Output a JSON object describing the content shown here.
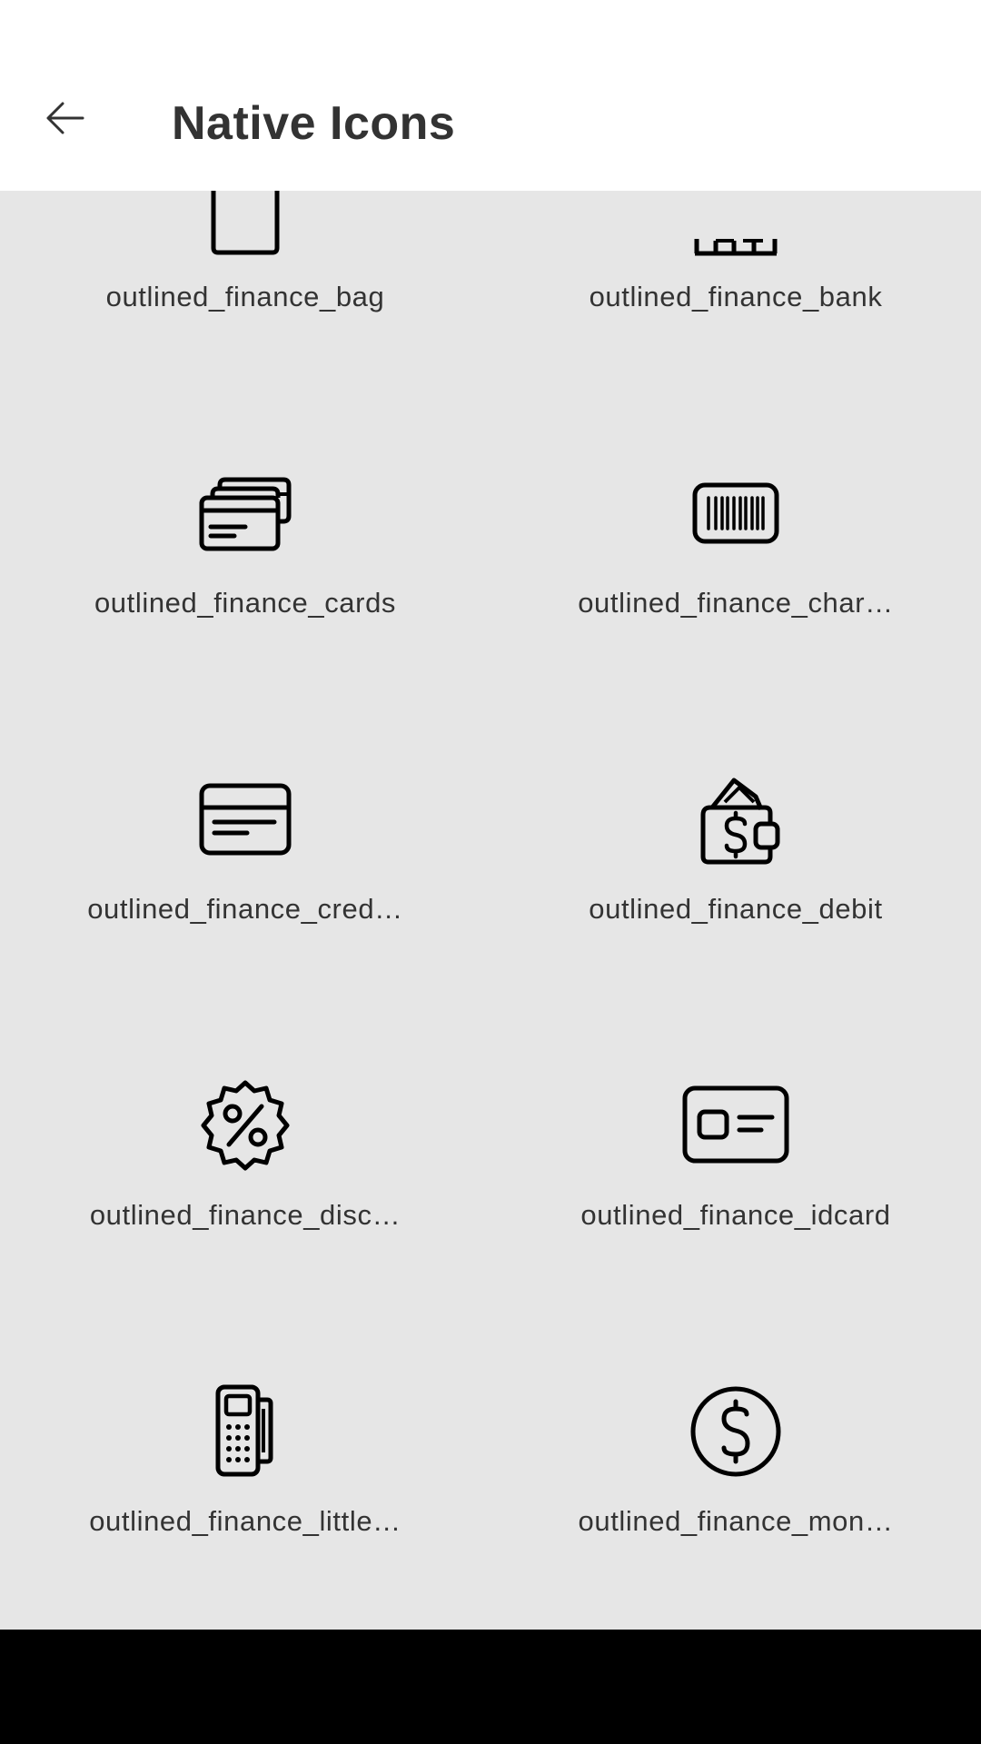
{
  "header": {
    "title": "Native Icons",
    "back_icon": "arrow-left-icon"
  },
  "icons": [
    {
      "label": "outlined_finance_bag",
      "icon": "finance-bag-icon"
    },
    {
      "label": "outlined_finance_bank",
      "icon": "finance-bank-icon"
    },
    {
      "label": "outlined_finance_cards",
      "icon": "finance-cards-icon"
    },
    {
      "label": "outlined_finance_char…",
      "icon": "finance-barcode-card-icon"
    },
    {
      "label": "outlined_finance_cred…",
      "icon": "finance-credit-card-icon"
    },
    {
      "label": "outlined_finance_debit",
      "icon": "finance-wallet-icon"
    },
    {
      "label": "outlined_finance_disc…",
      "icon": "finance-discount-icon"
    },
    {
      "label": "outlined_finance_idcard",
      "icon": "finance-idcard-icon"
    },
    {
      "label": "outlined_finance_little…",
      "icon": "finance-card-machine-icon"
    },
    {
      "label": "outlined_finance_mon…",
      "icon": "finance-money-icon"
    }
  ],
  "colors": {
    "background": "#e6e6e6",
    "header_background": "#ffffff",
    "text": "#333333",
    "icon_stroke": "#000000",
    "navbar": "#000000"
  }
}
